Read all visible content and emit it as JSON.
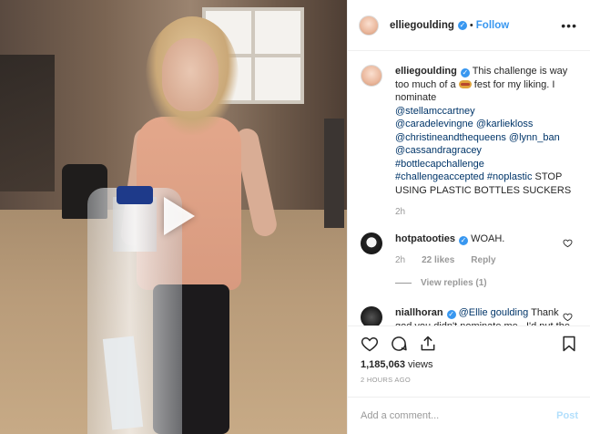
{
  "media": {
    "play_icon": "play-triangle-icon"
  },
  "header": {
    "username": "elliegoulding",
    "dot": "•",
    "follow_label": "Follow",
    "more_label": "•••"
  },
  "caption": {
    "username": "elliegoulding",
    "text_1": "This challenge is way too much of a",
    "emoji_name": "hot-dog-icon",
    "text_2": "fest for my liking. I nominate",
    "mentions": [
      "@stellamccartney",
      "@caradelevingne",
      "@karliekloss",
      "@christineandthequeens",
      "@lynn_ban",
      "@cassandragracey"
    ],
    "hashtags": [
      "#bottlecapchallenge",
      "#challengeaccepted",
      "#noplastic"
    ],
    "tail": "STOP USING PLASTIC BOTTLES SUCKERS",
    "time": "2h"
  },
  "comments": [
    {
      "username": "hotpatooties",
      "text": "WOAH.",
      "time": "2h",
      "likes": "22 likes",
      "reply": "Reply",
      "view_replies": "View replies (1)"
    },
    {
      "username": "niallhoran",
      "mention": "@Ellie goulding",
      "text": "Thank god you didn't nominate me , I'd put the bottle through"
    }
  ],
  "actions": {
    "like": "heart-icon",
    "comment": "comment-bubble-icon",
    "share": "share-arrow-icon",
    "save": "bookmark-icon"
  },
  "stats": {
    "views_count": "1,185,063",
    "views_label": "views",
    "posted": "2 HOURS AGO"
  },
  "add_comment": {
    "placeholder": "Add a comment...",
    "post_label": "Post"
  },
  "colors": {
    "accent": "#3897f0",
    "link": "#003569",
    "muted": "#999999",
    "post_disabled": "#b2dffc"
  }
}
